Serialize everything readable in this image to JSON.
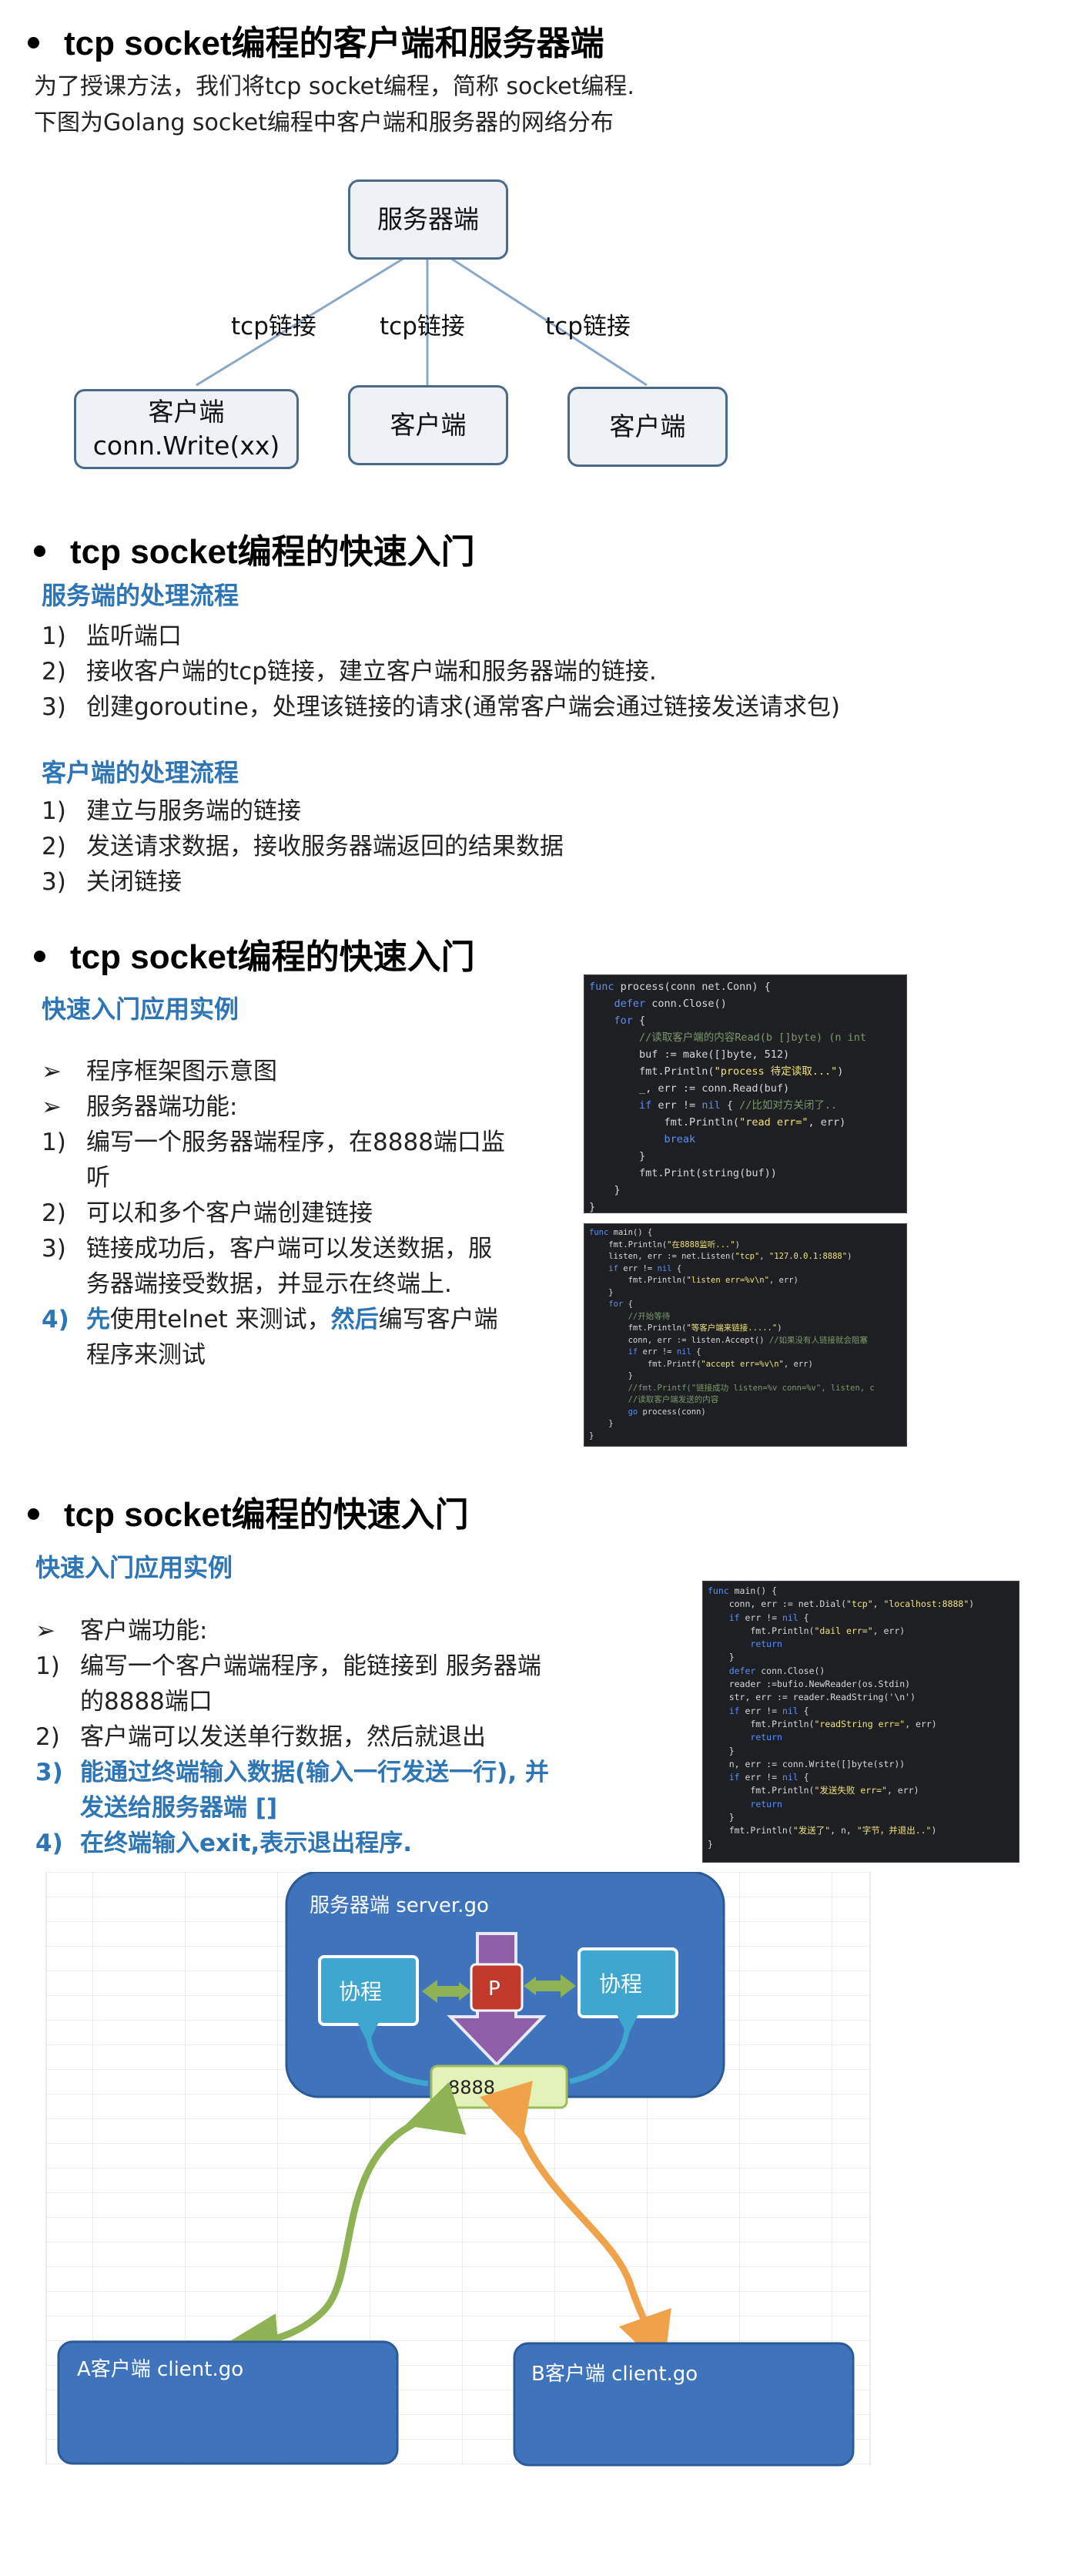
{
  "s1": {
    "heading": "tcp socket编程的客户端和服务器端",
    "intro1": "为了授课方法，我们将tcp socket编程，简称 socket编程.",
    "intro2": "下图为Golang socket编程中客户端和服务器的网络分布",
    "server": "服务器端",
    "link1": "tcp链接",
    "link2": "tcp链接",
    "link3": "tcp链接",
    "client1_line1": "客户端",
    "client1_line2": "conn.Write(xx)",
    "client2": "客户端",
    "client3": "客户端"
  },
  "s2": {
    "heading": "tcp socket编程的快速入门",
    "server_flow_title": "服务端的处理流程",
    "server_steps": [
      {
        "n": "1)",
        "t": "监听端口"
      },
      {
        "n": "2)",
        "t": "接收客户端的tcp链接，建立客户端和服务器端的链接."
      },
      {
        "n": "3)",
        "t": "创建goroutine，处理该链接的请求(通常客户端会通过链接发送请求包)"
      }
    ],
    "client_flow_title": "客户端的处理流程",
    "client_steps": [
      {
        "n": "1)",
        "t": "建立与服务端的链接"
      },
      {
        "n": "2)",
        "t": "发送请求数据，接收服务器端返回的结果数据"
      },
      {
        "n": "3)",
        "t": "关闭链接"
      }
    ]
  },
  "s3": {
    "heading": "tcp socket编程的快速入门",
    "subtitle": "快速入门应用实例",
    "b1": "程序框架图示意图",
    "b2": "服务器端功能:",
    "i1_n": "1)",
    "i1_a": "编写一个服务器端程序，在8888端口监",
    "i1_b": "听",
    "i2_n": "2)",
    "i2": "可以和多个客户端创建链接",
    "i3_n": "3)",
    "i3_a": "链接成功后，客户端可以发送数据，服",
    "i3_b": "务器端接受数据，并显示在终端上.",
    "i4_n": "4)",
    "i4_first": "先",
    "i4_mid1": "使用telnet 来测试，",
    "i4_then": "然后",
    "i4_mid2": "编写客户端",
    "i4_b": "程序来测试",
    "code1": [
      "func process(conn net.Conn) {",
      "    defer conn.Close()",
      "    for {",
      "        //读取客户端的内容Read(b []byte) (n int",
      "        buf := make([]byte, 512)",
      "        fmt.Println(\"process 待定读取...\")",
      "        _, err := conn.Read(buf)",
      "        if err != nil { //比如对方关闭了..",
      "            fmt.Println(\"read err=\", err)",
      "            break",
      "        }",
      "        fmt.Print(string(buf))",
      "    }",
      "}"
    ],
    "code2": [
      "func main() {",
      "    fmt.Println(\"在8888监听...\")",
      "    listen, err := net.Listen(\"tcp\", \"127.0.0.1:8888\")",
      "    if err != nil {",
      "        fmt.Println(\"listen err=%v\\n\", err)",
      "    }",
      "    for {",
      "        //开始等待",
      "        fmt.Println(\"等客户端来链接.....\")",
      "        conn, err := listen.Accept() //如果没有人链接就会阻塞",
      "        if err != nil {",
      "            fmt.Printf(\"accept err=%v\\n\", err)",
      "        }",
      "        //fmt.Printf(\"链接成功 listen=%v conn=%v\", listen, c",
      "        //读取客户端发送的内容",
      "        go process(conn)",
      "    }",
      "}"
    ]
  },
  "s4": {
    "heading": "tcp socket编程的快速入门",
    "subtitle": "快速入门应用实例",
    "b1": "客户端功能:",
    "i1_n": "1)",
    "i1_a": "编写一个客户端端程序，能链接到 服务器端",
    "i1_b": "的8888端口",
    "i2_n": "2)",
    "i2": "客户端可以发送单行数据，然后就退出",
    "i3_n": "3)",
    "i3_a": "能通过终端输入数据(输入一行发送一行), 并",
    "i3_b": "发送给服务器端 []",
    "i4_n": "4)",
    "i4": "在终端输入exit,表示退出程序.",
    "code3": [
      "func main() {",
      "    conn, err := net.Dial(\"tcp\", \"localhost:8888\")",
      "    if err != nil {",
      "        fmt.Println(\"dail err=\", err)",
      "        return",
      "    }",
      "    defer conn.Close()",
      "    reader :=bufio.NewReader(os.Stdin)",
      "    str, err := reader.ReadString('\\n')",
      "    if err != nil {",
      "        fmt.Println(\"readString err=\", err)",
      "        return",
      "    }",
      "    n, err := conn.Write([]byte(str))",
      "    if err != nil {",
      "        fmt.Println(\"发送失败 err=\", err)",
      "        return",
      "    }",
      "    fmt.Println(\"发送了\", n, \"字节，并退出..\")",
      "}"
    ]
  },
  "diagram2": {
    "server_title": "服务器端  server.go",
    "goroutine1": "协程",
    "goroutine2": "协程",
    "p_label": "P",
    "port": "8888",
    "clientA": "A客户端  client.go",
    "clientB": "B客户端  client.go",
    "colors": {
      "server_fill": "#3f74bd",
      "client_fill": "#3f74bd",
      "goroutine_fill": "#3ea6cf",
      "p_fill": "#c0392b",
      "arrow_purple": "#8e5fa8",
      "arrow_green": "#8fb254",
      "arrow_orange": "#f0a24a",
      "port_fill": "#e3f2b8"
    }
  }
}
